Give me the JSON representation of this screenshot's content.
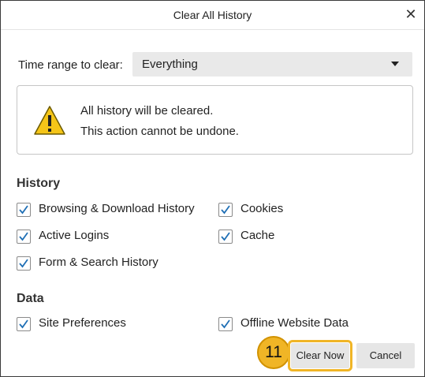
{
  "window": {
    "title": "Clear All History",
    "close_glyph": "✕"
  },
  "time_range": {
    "label": "Time range to clear:",
    "value": "Everything"
  },
  "warning": {
    "line1": "All history will be cleared.",
    "line2": "This action cannot be undone.",
    "icon": "warning-icon"
  },
  "history": {
    "heading": "History",
    "items": [
      {
        "label": "Browsing & Download History",
        "checked": true
      },
      {
        "label": "Cookies",
        "checked": true
      },
      {
        "label": "Active Logins",
        "checked": true
      },
      {
        "label": "Cache",
        "checked": true
      },
      {
        "label": "Form & Search History",
        "checked": true
      }
    ]
  },
  "data_section": {
    "heading": "Data",
    "items": [
      {
        "label": "Site Preferences",
        "checked": true
      },
      {
        "label": "Offline Website Data",
        "checked": true
      }
    ]
  },
  "buttons": {
    "clear_now": "Clear Now",
    "cancel": "Cancel"
  },
  "step_badge": "11",
  "colors": {
    "highlight": "#f0b526",
    "check": "#1f6fb5",
    "button_bg": "#e6e6e6"
  }
}
